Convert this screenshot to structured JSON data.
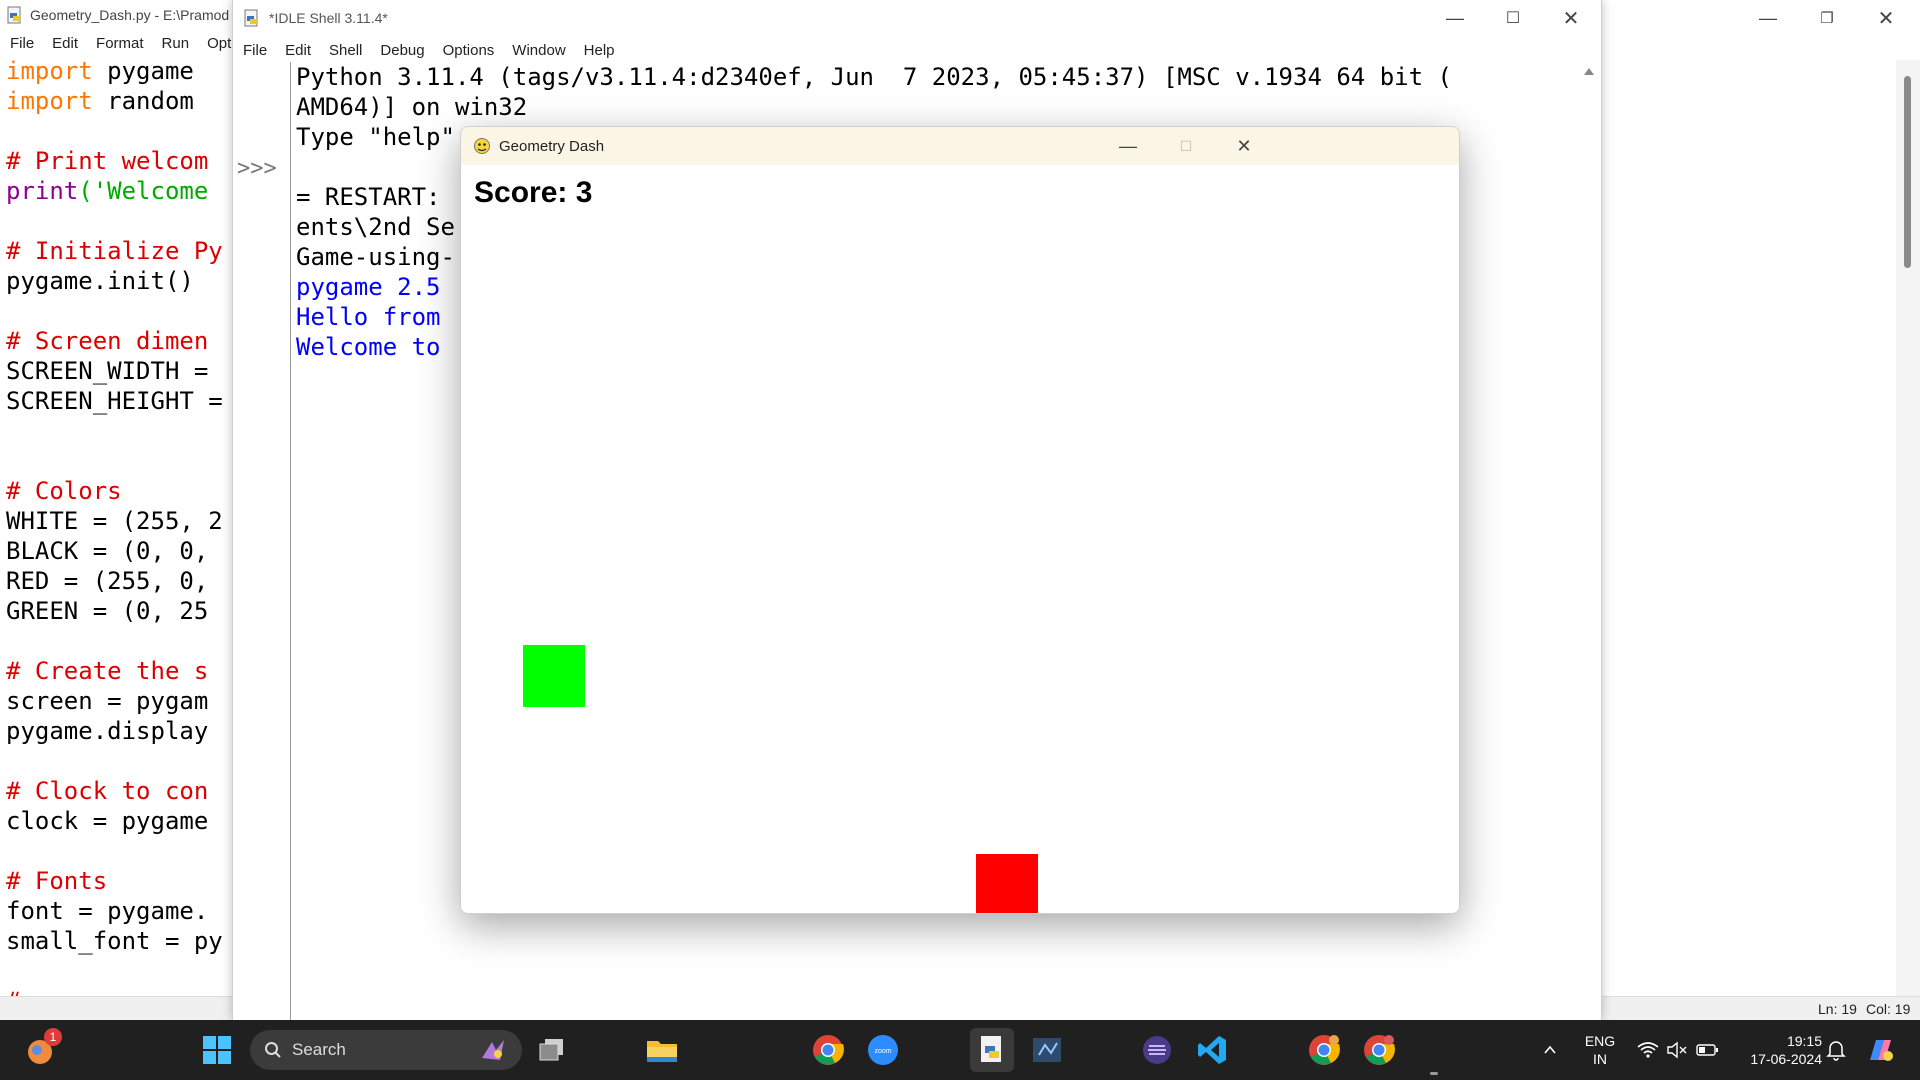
{
  "editor": {
    "title": "Geometry_Dash.py - E:\\Pramod",
    "menu": [
      "File",
      "Edit",
      "Format",
      "Run",
      "Opti"
    ],
    "lines": [
      [
        {
          "t": "import",
          "c": "kw"
        },
        {
          "t": " pygame",
          "c": ""
        }
      ],
      [
        {
          "t": "import",
          "c": "kw"
        },
        {
          "t": " random",
          "c": ""
        }
      ],
      [],
      [
        {
          "t": "# Print welcom",
          "c": "cm"
        }
      ],
      [
        {
          "t": "print",
          "c": "bi"
        },
        {
          "t": "('Welcome",
          "c": "st"
        }
      ],
      [],
      [
        {
          "t": "# Initialize Py",
          "c": "cm"
        }
      ],
      [
        {
          "t": "pygame.init()",
          "c": ""
        }
      ],
      [],
      [
        {
          "t": "# Screen dimen",
          "c": "cm"
        }
      ],
      [
        {
          "t": "SCREEN_WIDTH =",
          "c": ""
        }
      ],
      [
        {
          "t": "SCREEN_HEIGHT =",
          "c": ""
        }
      ],
      [],
      [],
      [
        {
          "t": "# Colors",
          "c": "cm"
        }
      ],
      [
        {
          "t": "WHITE = (255, 2",
          "c": ""
        }
      ],
      [
        {
          "t": "BLACK = (0, 0,",
          "c": ""
        }
      ],
      [
        {
          "t": "RED = (255, 0,",
          "c": ""
        }
      ],
      [
        {
          "t": "GREEN = (0, 25",
          "c": ""
        }
      ],
      [],
      [
        {
          "t": "# Create the s",
          "c": "cm"
        }
      ],
      [
        {
          "t": "screen = pygam",
          "c": ""
        }
      ],
      [
        {
          "t": "pygame.display",
          "c": ""
        }
      ],
      [],
      [
        {
          "t": "# Clock to con",
          "c": "cm"
        }
      ],
      [
        {
          "t": "clock = pygame",
          "c": ""
        }
      ],
      [],
      [
        {
          "t": "# Fonts",
          "c": "cm"
        }
      ],
      [
        {
          "t": "font = pygame.",
          "c": ""
        }
      ],
      [
        {
          "t": "small_font = py",
          "c": ""
        }
      ],
      [],
      [
        {
          "t": "# ...",
          "c": "cm"
        }
      ]
    ],
    "status_line": "Ln: 19",
    "status_col": "Col: 19"
  },
  "shell": {
    "title": "*IDLE Shell 3.11.4*",
    "menu": [
      "File",
      "Edit",
      "Shell",
      "Debug",
      "Options",
      "Window",
      "Help"
    ],
    "prompt": ">>>",
    "lines": [
      {
        "t": "Python 3.11.4 (tags/v3.11.4:d2340ef, Jun  7 2023, 05:45:37) [MSC v.1934 64 bit (",
        "c": ""
      },
      {
        "t": "AMD64)] on win32",
        "c": ""
      },
      {
        "t": "Type \"help\"",
        "c": ""
      },
      {
        "t": "",
        "c": ""
      },
      {
        "t": "= RESTART:                                              r-Docum",
        "c": ""
      },
      {
        "t": "ents\\2nd Se                                             y-Dash-",
        "c": ""
      },
      {
        "t": "Game-using-",
        "c": ""
      },
      {
        "t": "pygame 2.5",
        "c": "blue"
      },
      {
        "t": "Hello from",
        "c": "blue"
      },
      {
        "t": "Welcome to",
        "c": "blue"
      }
    ]
  },
  "game": {
    "title": "Geometry Dash",
    "score_text": "Score: 3",
    "colors": {
      "player": "#00ff00",
      "obstacle": "#ff0000",
      "background": "#ffffff"
    }
  },
  "taskbar": {
    "search_label": "Search",
    "language": "ENG",
    "region": "IN",
    "time": "19:15",
    "date": "17-06-2024",
    "notification_badge": "1"
  }
}
